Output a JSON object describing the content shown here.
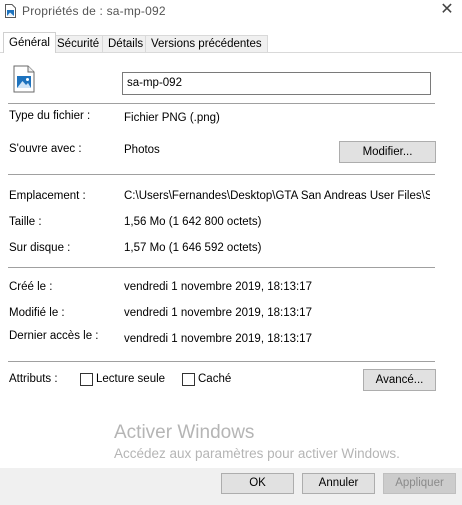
{
  "window": {
    "title": "Propriétés de : sa-mp-092",
    "close_glyph": "✕"
  },
  "tabs": [
    {
      "label": "Général",
      "active": true
    },
    {
      "label": "Sécurité",
      "active": false
    },
    {
      "label": "Détails",
      "active": false
    },
    {
      "label": "Versions précédentes",
      "active": false
    }
  ],
  "general": {
    "file_icon": "image-file-icon",
    "filename": "sa-mp-092",
    "file_type_label": "Type du fichier :",
    "file_type_value": "Fichier PNG (.png)",
    "opens_with_label": "S'ouvre avec :",
    "opens_with_value": "Photos",
    "modify_button": "Modifier...",
    "location_label": "Emplacement :",
    "location_value": "C:\\Users\\Fernandes\\Desktop\\GTA San Andreas User Files\\SAMP",
    "size_label": "Taille :",
    "size_value": "1,56 Mo (1 642 800 octets)",
    "disk_size_label": "Sur disque :",
    "disk_size_value": "1,57 Mo (1 646 592 octets)",
    "created_label": "Créé le :",
    "created_value": "vendredi 1 novembre 2019, 18:13:17",
    "modified_label": "Modifié le :",
    "modified_value": "vendredi 1 novembre 2019, 18:13:17",
    "accessed_label": "Dernier accès le :",
    "accessed_value": "vendredi 1 novembre 2019, 18:13:17",
    "attributes_label": "Attributs :",
    "readonly_label": "Lecture seule",
    "readonly_checked": false,
    "hidden_label": "Caché",
    "hidden_checked": false,
    "advanced_button": "Avancé..."
  },
  "watermark": {
    "title": "Activer Windows",
    "subtitle": "Accédez aux paramètres pour activer Windows."
  },
  "footer": {
    "ok": "OK",
    "cancel": "Annuler",
    "apply": "Appliquer"
  },
  "colors": {
    "accent_icon": "#1e73be",
    "button_bg": "#e1e1e1",
    "disabled_text": "#a0a0a0"
  }
}
